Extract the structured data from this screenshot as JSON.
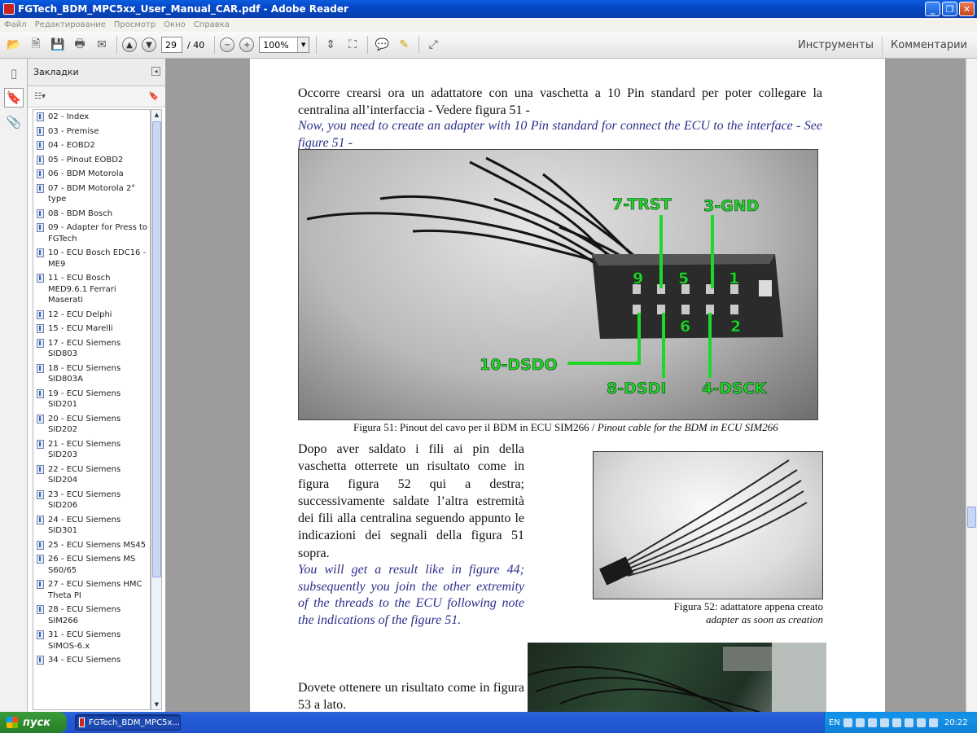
{
  "window": {
    "title": "FGTech_BDM_MPC5xx_User_Manual_CAR.pdf - Adobe Reader",
    "minimize": "_",
    "maximize": "❐",
    "close": "✕"
  },
  "menu": [
    "Файл",
    "Редактирование",
    "Просмотр",
    "Окно",
    "Справка"
  ],
  "toolbar": {
    "page_current": "29",
    "page_total": "/ 40",
    "zoom": "100%",
    "tools_label": "Инструменты",
    "comments_label": "Комментарии"
  },
  "bookmarks_panel": {
    "title": "Закладки",
    "items": [
      "02 - Index",
      "03 - Premise",
      "04 - EOBD2",
      "05 - Pinout EOBD2",
      "06 - BDM Motorola",
      "07 - BDM Motorola 2° type",
      "08 - BDM Bosch",
      "09 - Adapter for Press to FGTech",
      "10 - ECU Bosch EDC16 - ME9",
      "11 - ECU Bosch MED9.6.1 Ferrari Maserati",
      "12 - ECU Delphi",
      "15 - ECU Marelli",
      "17 - ECU Siemens SID803",
      "18 - ECU Siemens SID803A",
      "19 - ECU Siemens SID201",
      "20 - ECU Siemens SID202",
      "21 - ECU Siemens SID203",
      "22 - ECU Siemens SID204",
      "23 - ECU Siemens SID206",
      "24 - ECU Siemens SID301",
      "25 - ECU Siemens MS45",
      "26 - ECU Siemens MS S60/65",
      "27 - ECU Siemens HMC Theta PI",
      "28 - ECU Siemens SIM266",
      "31 - ECU Siemens SIMOS-6.x",
      "34 - ECU Siemens"
    ]
  },
  "document": {
    "para1_it": "Occorre crearsi ora un adattatore con una vaschetta a 10 Pin standard per poter collegare la centralina all’interfaccia - Vedere figura 51 -",
    "para1_en": "Now, you need to create an adapter with 10 Pin standard for connect the ECU to the interface - See figure 51 -",
    "fig51_labels": {
      "trst": "7-TRST",
      "gnd": "3-GND",
      "dsdo": "10-DSDO",
      "dsdi": "8-DSDI",
      "dsck": "4-DSCK",
      "p9": "9",
      "p5": "5",
      "p1": "1",
      "p6": "6",
      "p2": "2"
    },
    "fig51_caption_it": "Figura 51: Pinout del cavo per il BDM in ECU SIM266 / ",
    "fig51_caption_en": "Pinout cable for the BDM in ECU SIM266",
    "para2_it": "Dopo aver saldato i fili ai pin della vaschetta otterrete un risultato come in figura figura 52 qui a destra; successivamente saldate l’altra estremità dei fili alla centralina seguendo appunto le indicazioni dei segnali della figura 51 sopra.",
    "para2_en": "You will get a result like in figure 44; subsequently you join the other extremity of the threads to the ECU following note the indications of the figure 51.",
    "fig52_caption_it": "Figura 52: adattatore appena creato",
    "fig52_caption_en": "adapter as soon as creation",
    "para3_it": "Dovete ottenere un risultato come in figura 53 a lato."
  },
  "taskbar": {
    "start": "пуск",
    "task": "FGTech_BDM_MPC5x...",
    "lang": "EN",
    "clock": "20:22"
  },
  "colors": {
    "label_green": "#1fd62a",
    "doc_blue": "#2a2f8a"
  }
}
